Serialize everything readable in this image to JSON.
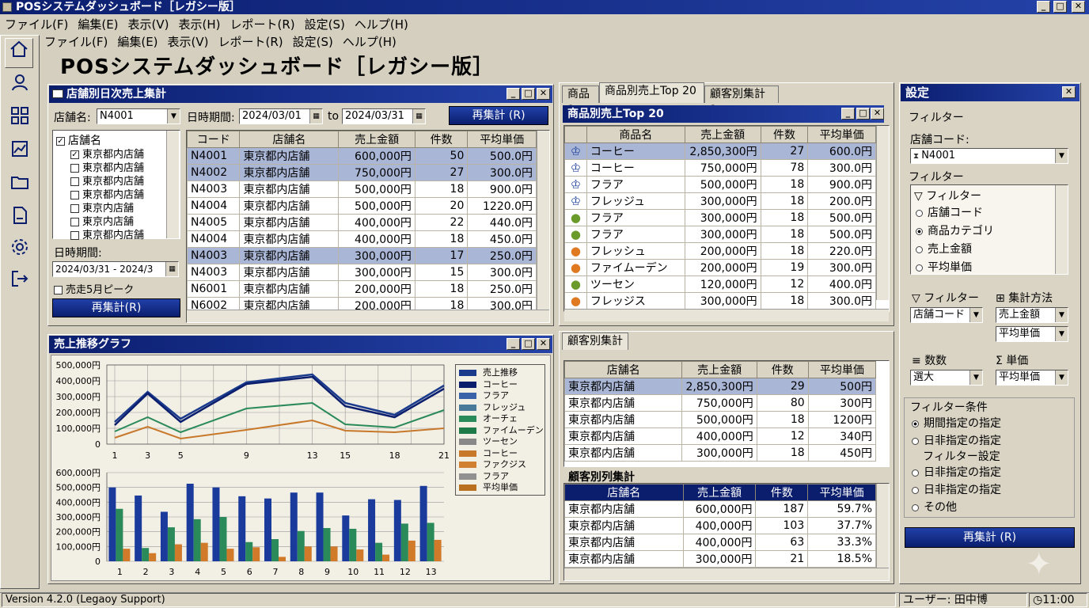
{
  "app": {
    "window_title": "POSシステムダッシュボード［レガシー版］",
    "page_title": "POSシステムダッシュボード［レガシー版］"
  },
  "menu1": [
    "ファイル(F)",
    "編集(E)",
    "表示(V)",
    "表示(H)",
    "レポート(R)",
    "設定(S)",
    "ヘルプ(H)"
  ],
  "menu2": [
    "ファイル(F)",
    "編集(E)",
    "表示(V)",
    "レポート(R)",
    "設定(S)",
    "ヘルプ(H)"
  ],
  "store_panel": {
    "title": "店舗別日次売上集計",
    "store_label": "店舗名:",
    "store_value": "N4001",
    "date_label": "日時期間:",
    "date_from": "2024/03/01",
    "to_label": "to",
    "date_to": "2024/03/31",
    "recalc": "再集計 (R)",
    "tree_root": "店舗名",
    "tree_items": [
      {
        "label": "東京都内店舗",
        "checked": true
      },
      {
        "label": "東京都内店舗",
        "checked": false
      },
      {
        "label": "東京都内店舗",
        "checked": false
      },
      {
        "label": "東京都内店舗",
        "checked": false
      },
      {
        "label": "東京内店舗",
        "checked": false
      },
      {
        "label": "東京内店舗",
        "checked": false
      },
      {
        "label": "東京都内店舗",
        "checked": false
      }
    ],
    "period_label": "日時期間:",
    "period_value": "2024/03/31 - 2024/3",
    "checkbox_label": "売走5月ピーク",
    "recalc2": "再集計(R)",
    "columns": [
      "コード",
      "店舗名",
      "売上金額",
      "件数",
      "平均単価"
    ],
    "rows": [
      [
        "N4001",
        "東京都内店舗",
        "600,000円",
        "50",
        "500.0円"
      ],
      [
        "N4002",
        "東京都内店舗",
        "750,000円",
        "27",
        "300.0円"
      ],
      [
        "N4003",
        "東京都内店舗",
        "500,000円",
        "18",
        "900.0円"
      ],
      [
        "N4004",
        "東京都内店舗",
        "500,000円",
        "20",
        "1220.0円"
      ],
      [
        "N4005",
        "東京都内店舗",
        "400,000円",
        "22",
        "440.0円"
      ],
      [
        "N4004",
        "東京都内店舗",
        "400,000円",
        "18",
        "450.0円"
      ],
      [
        "N4003",
        "東京都内店舗",
        "300,000円",
        "17",
        "250.0円"
      ],
      [
        "N4003",
        "東京都内店舗",
        "300,000円",
        "15",
        "300.0円"
      ],
      [
        "N6001",
        "東京都内店舗",
        "200,000円",
        "18",
        "250.0円"
      ],
      [
        "N6002",
        "東京都内店舗",
        "200,000円",
        "18",
        "300.0円"
      ]
    ],
    "selected_rows": [
      0,
      1,
      6
    ]
  },
  "chart_panel": {
    "title": "売上推移グラフ"
  },
  "chart_data": [
    {
      "type": "line",
      "x": [
        1,
        3,
        5,
        9,
        13,
        15,
        18,
        21
      ],
      "ylim": [
        0,
        500000
      ],
      "yticks": [
        "500,000円",
        "400,000円",
        "300,000円",
        "200,000円",
        "100,000円",
        "0"
      ],
      "series": [
        {
          "values": [
            140000,
            330000,
            160000,
            390000,
            440000,
            260000,
            185000,
            370000
          ]
        },
        {
          "values": [
            120000,
            320000,
            140000,
            380000,
            425000,
            240000,
            170000,
            350000
          ]
        },
        {
          "values": [
            80000,
            170000,
            75000,
            225000,
            260000,
            125000,
            105000,
            215000
          ]
        },
        {
          "values": [
            40000,
            110000,
            35000,
            90000,
            150000,
            85000,
            75000,
            100000
          ]
        }
      ]
    },
    {
      "type": "bar",
      "categories": [
        "1",
        "2",
        "3",
        "4",
        "5",
        "6",
        "7",
        "8",
        "9",
        "10",
        "11",
        "12",
        "13"
      ],
      "ylim": [
        0,
        600000
      ],
      "yticks": [
        "600,000円",
        "500,000円",
        "400,000円",
        "300,000円",
        "200,000円",
        "100,000円",
        "0"
      ],
      "series": [
        {
          "values": [
            500000,
            445000,
            335000,
            525000,
            500000,
            440000,
            425000,
            465000,
            465000,
            310000,
            420000,
            415000,
            510000
          ]
        },
        {
          "values": [
            355000,
            90000,
            230000,
            285000,
            300000,
            130000,
            150000,
            205000,
            225000,
            220000,
            125000,
            255000,
            260000
          ]
        },
        {
          "values": [
            85000,
            55000,
            115000,
            125000,
            85000,
            95000,
            30000,
            100000,
            100000,
            80000,
            45000,
            140000,
            145000
          ]
        }
      ]
    }
  ],
  "legend": [
    {
      "label": "売上推移",
      "color": "#1a3a8c"
    },
    {
      "label": "コーヒー",
      "color": "#0b1e6e"
    },
    {
      "label": "フラア",
      "color": "#3a62a8"
    },
    {
      "label": "フレッジュ",
      "color": "#4a7a9a"
    },
    {
      "label": "オーチェ",
      "color": "#2a8a5a"
    },
    {
      "label": "ファイムーデン",
      "color": "#1f7a4a"
    },
    {
      "label": "ツーセン",
      "color": "#888888"
    },
    {
      "label": "コーヒー",
      "color": "#c8782a"
    },
    {
      "label": "ファクジス",
      "color": "#d08030"
    },
    {
      "label": "フラア",
      "color": "#909090"
    },
    {
      "label": "平均単価",
      "color": "#b87020"
    }
  ],
  "colors": {
    "line1": "#1a3a8c",
    "line2": "#0b1e6e",
    "line3": "#2a8a5a",
    "line4": "#c8782a",
    "bar1": "#1a3a9c",
    "bar2": "#2a8a5a",
    "bar3": "#d07a2a"
  },
  "product_panel": {
    "tabs": [
      "商品 1",
      "商品別売上Top 20",
      "顧客別集計 2"
    ],
    "title": "商品別売上Top 20",
    "columns": [
      "商品名",
      "売上金額",
      "件数",
      "平均単価"
    ],
    "rows": [
      {
        "icon": "crown-icon",
        "cells": [
          "コーヒー",
          "2,850,300円",
          "27",
          "600.0円"
        ]
      },
      {
        "icon": "crown-icon",
        "cells": [
          "コーヒー",
          "750,000円",
          "78",
          "300.0円"
        ]
      },
      {
        "icon": "crown-icon",
        "cells": [
          "フラア",
          "500,000円",
          "18",
          "900.0円"
        ]
      },
      {
        "icon": "crown-icon",
        "cells": [
          "フレッジュ",
          "300,000円",
          "18",
          "200.0円"
        ]
      },
      {
        "icon": "apple-icon",
        "cells": [
          "フラア",
          "300,000円",
          "18",
          "500.0円"
        ]
      },
      {
        "icon": "apple-icon",
        "cells": [
          "フラア",
          "300,000円",
          "18",
          "500.0円"
        ]
      },
      {
        "icon": "orange-icon",
        "cells": [
          "フレッシュ",
          "200,000円",
          "18",
          "220.0円"
        ]
      },
      {
        "icon": "orange-icon",
        "cells": [
          "ファイムーデン",
          "200,000円",
          "19",
          "300.0円"
        ]
      },
      {
        "icon": "apple-icon",
        "cells": [
          "ツーセン",
          "120,000円",
          "12",
          "400.0円"
        ]
      },
      {
        "icon": "orange-icon",
        "cells": [
          "フレッジス",
          "300,000円",
          "18",
          "300.0円"
        ]
      }
    ]
  },
  "customer_panel": {
    "tab": "顧客別集計",
    "columns": [
      "店舗名",
      "売上金額",
      "件数",
      "平均単価"
    ],
    "rows": [
      [
        "東京都内店舗",
        "2,850,300円",
        "29",
        "500円"
      ],
      [
        "東京都内店舗",
        "750,000円",
        "80",
        "300円"
      ],
      [
        "東京都内店舗",
        "500,000円",
        "18",
        "1200円"
      ],
      [
        "東京都内店舗",
        "400,000円",
        "12",
        "340円"
      ],
      [
        "東京都内店舗",
        "300,000円",
        "18",
        "450円"
      ]
    ],
    "sub_title": "顧客別列集計",
    "sub_columns": [
      "店舗名",
      "売上金額",
      "件数",
      "平均単価"
    ],
    "sub_rows": [
      [
        "東京都内店舗",
        "600,000円",
        "187",
        "59.7%"
      ],
      [
        "東京都内店舗",
        "400,000円",
        "103",
        "37.7%"
      ],
      [
        "東京都内店舗",
        "400,000円",
        "63",
        "33.3%"
      ],
      [
        "東京都内店舗",
        "300,000円",
        "21",
        "18.5%"
      ]
    ]
  },
  "settings": {
    "title": "設定",
    "filter_section": "フィルター",
    "store_code_label": "店舗コード:",
    "store_code_value": "N4001",
    "filter_section2": "フィルター",
    "filter_list_title": "フィルター",
    "filter_options": [
      {
        "label": "店舗コード",
        "on": false
      },
      {
        "label": "商品カテゴリ",
        "on": true
      },
      {
        "label": "売上金額",
        "on": false
      },
      {
        "label": "平均単価",
        "on": false
      }
    ],
    "filter_label": "フィルター",
    "agg_label": "集計方法",
    "filter_combo": "店舗コード",
    "agg_combo1": "売上金額",
    "agg_combo2": "平均単価",
    "count_label": "数数",
    "unit_label": "単価",
    "count_combo": "選大",
    "unit_combo": "平均単価",
    "cond_title": "フィルター条件",
    "cond_options": [
      {
        "label": "期間指定の指定",
        "on": true
      },
      {
        "label": "日非指定の指定",
        "on": false
      }
    ],
    "cond_sub": "フィルター設定",
    "cond_options2": [
      {
        "label": "日非指定の指定",
        "on": false
      },
      {
        "label": "日非指定の指定",
        "on": false
      },
      {
        "label": "その他",
        "on": false
      }
    ],
    "recalc": "再集計 (R)"
  },
  "status": {
    "version": "Version 4.2.0 (Legaoy Support)",
    "user": "ユーザー: 田中博",
    "time": "11:00"
  }
}
